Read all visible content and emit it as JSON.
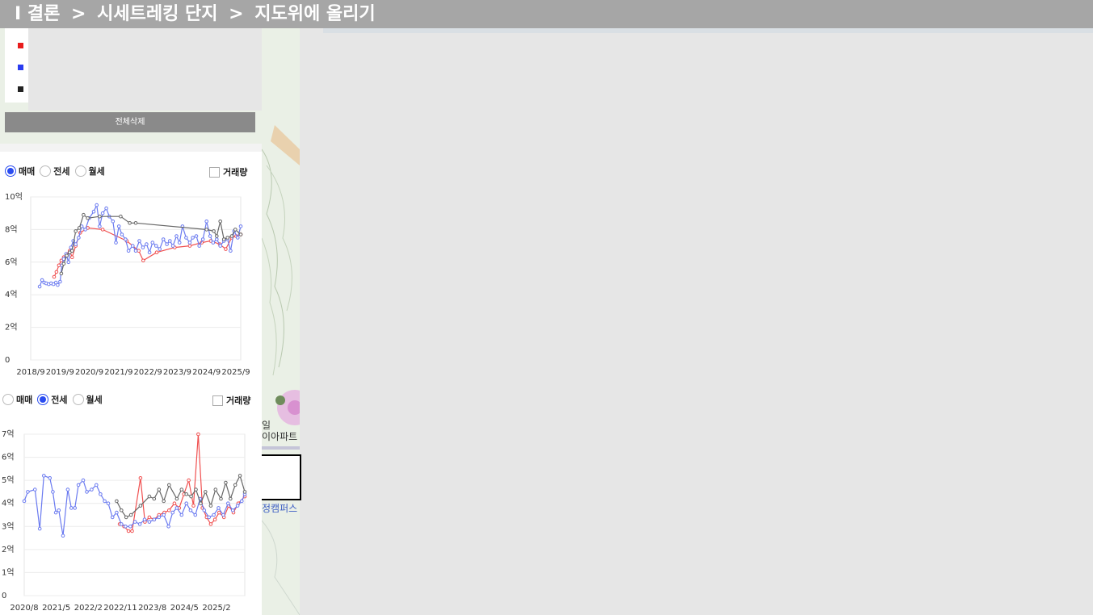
{
  "breadcrumb": {
    "prefix": "I",
    "items": [
      "결론",
      "시세트레킹 단지",
      "지도위에 올리기"
    ],
    "separator": ">"
  },
  "map": {
    "labels": [
      "일",
      "이아파트",
      "정캠퍼스"
    ]
  },
  "legend": {
    "colors": [
      "#e81c1c",
      "#2a3cf0",
      "#222222"
    ]
  },
  "delete_all_label": "전체삭제",
  "charts": [
    {
      "radios": [
        {
          "label": "매매",
          "checked": true
        },
        {
          "label": "전세",
          "checked": false
        },
        {
          "label": "월세",
          "checked": false
        }
      ],
      "volume_label": "거래량",
      "chart_data": {
        "type": "line",
        "y_ticks": [
          "10억",
          "8억",
          "6억",
          "4억",
          "2억",
          "0"
        ],
        "ylim": [
          0,
          10
        ],
        "x_ticks": [
          "2018/9",
          "2019/9",
          "2020/9",
          "2021/9",
          "2022/9",
          "2023/9",
          "2024/9",
          "2025/9"
        ],
        "xlim": [
          0,
          7
        ],
        "grid": true,
        "series": [
          {
            "color": "#f05050",
            "points": [
              [
                0.78,
                5.1
              ],
              [
                0.86,
                5.4
              ],
              [
                0.94,
                5.8
              ],
              [
                1.02,
                6.1
              ],
              [
                1.1,
                6.3
              ],
              [
                1.2,
                6.5
              ],
              [
                1.3,
                6.7
              ],
              [
                1.38,
                6.3
              ],
              [
                1.5,
                7.0
              ],
              [
                1.65,
                7.8
              ],
              [
                1.9,
                8.1
              ],
              [
                2.4,
                8.0
              ],
              [
                3.2,
                7.3
              ],
              [
                3.6,
                6.7
              ],
              [
                3.75,
                6.1
              ],
              [
                4.2,
                6.6
              ],
              [
                4.8,
                6.9
              ],
              [
                5.3,
                7.0
              ],
              [
                5.7,
                7.2
              ],
              [
                6.0,
                7.3
              ],
              [
                6.3,
                7.1
              ],
              [
                6.5,
                6.8
              ],
              [
                6.7,
                7.5
              ],
              [
                6.85,
                7.6
              ],
              [
                7.0,
                7.7
              ]
            ]
          },
          {
            "color": "#6a7af0",
            "points": [
              [
                0.3,
                4.5
              ],
              [
                0.38,
                4.9
              ],
              [
                0.45,
                4.75
              ],
              [
                0.52,
                4.7
              ],
              [
                0.6,
                4.65
              ],
              [
                0.68,
                4.7
              ],
              [
                0.76,
                4.65
              ],
              [
                0.84,
                4.75
              ],
              [
                0.9,
                4.6
              ],
              [
                0.98,
                4.8
              ],
              [
                1.04,
                5.8
              ],
              [
                1.1,
                6.2
              ],
              [
                1.18,
                6.5
              ],
              [
                1.26,
                6.0
              ],
              [
                1.34,
                6.9
              ],
              [
                1.42,
                7.3
              ],
              [
                1.5,
                7.1
              ],
              [
                1.6,
                7.5
              ],
              [
                1.7,
                8.2
              ],
              [
                1.82,
                8.0
              ],
              [
                1.95,
                8.7
              ],
              [
                2.1,
                9.1
              ],
              [
                2.2,
                9.5
              ],
              [
                2.3,
                8.2
              ],
              [
                2.4,
                9.0
              ],
              [
                2.52,
                9.3
              ],
              [
                2.62,
                8.8
              ],
              [
                2.74,
                8.5
              ],
              [
                2.84,
                7.2
              ],
              [
                2.94,
                8.2
              ],
              [
                3.04,
                7.7
              ],
              [
                3.16,
                7.4
              ],
              [
                3.26,
                6.7
              ],
              [
                3.4,
                7.0
              ],
              [
                3.5,
                6.7
              ],
              [
                3.62,
                7.3
              ],
              [
                3.74,
                6.9
              ],
              [
                3.86,
                7.1
              ],
              [
                3.96,
                6.6
              ],
              [
                4.06,
                7.2
              ],
              [
                4.18,
                7.0
              ],
              [
                4.3,
                6.8
              ],
              [
                4.42,
                7.4
              ],
              [
                4.54,
                7.1
              ],
              [
                4.64,
                7.3
              ],
              [
                4.74,
                7.0
              ],
              [
                4.86,
                7.6
              ],
              [
                4.96,
                7.2
              ],
              [
                5.06,
                8.2
              ],
              [
                5.18,
                7.5
              ],
              [
                5.3,
                7.2
              ],
              [
                5.4,
                7.5
              ],
              [
                5.52,
                7.6
              ],
              [
                5.62,
                7.0
              ],
              [
                5.74,
                7.4
              ],
              [
                5.86,
                8.5
              ],
              [
                5.98,
                7.6
              ],
              [
                6.08,
                7.2
              ],
              [
                6.2,
                7.4
              ],
              [
                6.32,
                7.0
              ],
              [
                6.44,
                7.3
              ],
              [
                6.56,
                7.4
              ],
              [
                6.66,
                6.7
              ],
              [
                6.78,
                7.9
              ],
              [
                6.9,
                7.5
              ],
              [
                7.0,
                8.2
              ]
            ]
          },
          {
            "color": "#666666",
            "points": [
              [
                1.02,
                5.3
              ],
              [
                1.1,
                5.9
              ],
              [
                1.2,
                6.4
              ],
              [
                1.3,
                6.6
              ],
              [
                1.38,
                6.7
              ],
              [
                1.5,
                7.9
              ],
              [
                1.62,
                8.1
              ],
              [
                1.76,
                8.9
              ],
              [
                1.9,
                8.7
              ],
              [
                2.3,
                8.8
              ],
              [
                3.0,
                8.8
              ],
              [
                3.3,
                8.4
              ],
              [
                3.5,
                8.4
              ],
              [
                5.86,
                8.0
              ],
              [
                6.1,
                7.9
              ],
              [
                6.2,
                7.6
              ],
              [
                6.32,
                8.5
              ],
              [
                6.44,
                7.4
              ],
              [
                6.56,
                7.5
              ],
              [
                6.7,
                7.6
              ],
              [
                6.82,
                8.0
              ],
              [
                7.0,
                7.7
              ]
            ]
          }
        ]
      }
    },
    {
      "radios": [
        {
          "label": "매매",
          "checked": false
        },
        {
          "label": "전세",
          "checked": true
        },
        {
          "label": "월세",
          "checked": false
        }
      ],
      "volume_label": "거래량",
      "chart_data": {
        "type": "line",
        "y_ticks": [
          "7억",
          "6억",
          "5억",
          "4억",
          "3억",
          "2억",
          "1억",
          "0"
        ],
        "ylim": [
          0,
          7
        ],
        "x_ticks": [
          "2020/8",
          "2021/5",
          "2022/2",
          "2022/11",
          "2023/8",
          "2024/5",
          "2025/2"
        ],
        "xlim": [
          0,
          7.4
        ],
        "grid": true,
        "series": [
          {
            "color": "#f05050",
            "points": [
              [
                3.2,
                3.1
              ],
              [
                3.35,
                3.0
              ],
              [
                3.5,
                2.8
              ],
              [
                3.62,
                2.8
              ],
              [
                3.9,
                5.1
              ],
              [
                4.05,
                3.2
              ],
              [
                4.2,
                3.4
              ],
              [
                4.36,
                3.3
              ],
              [
                4.52,
                3.5
              ],
              [
                4.7,
                3.6
              ],
              [
                4.86,
                3.7
              ],
              [
                5.04,
                4.0
              ],
              [
                5.2,
                3.8
              ],
              [
                5.36,
                4.4
              ],
              [
                5.52,
                5.0
              ],
              [
                5.68,
                3.9
              ],
              [
                5.84,
                7.0
              ],
              [
                5.98,
                3.8
              ],
              [
                6.12,
                3.4
              ],
              [
                6.26,
                3.1
              ],
              [
                6.4,
                3.3
              ],
              [
                6.54,
                3.6
              ],
              [
                6.7,
                3.4
              ],
              [
                6.86,
                3.9
              ],
              [
                7.02,
                3.6
              ],
              [
                7.18,
                4.0
              ],
              [
                7.4,
                4.3
              ]
            ]
          },
          {
            "color": "#6a7af0",
            "points": [
              [
                0.0,
                4.1
              ],
              [
                0.12,
                4.5
              ],
              [
                0.36,
                4.6
              ],
              [
                0.52,
                2.9
              ],
              [
                0.66,
                5.2
              ],
              [
                0.86,
                5.1
              ],
              [
                0.96,
                4.5
              ],
              [
                1.06,
                3.6
              ],
              [
                1.16,
                3.7
              ],
              [
                1.3,
                2.6
              ],
              [
                1.46,
                4.6
              ],
              [
                1.58,
                3.8
              ],
              [
                1.7,
                3.8
              ],
              [
                1.82,
                4.8
              ],
              [
                1.98,
                5.0
              ],
              [
                2.1,
                4.5
              ],
              [
                2.26,
                4.6
              ],
              [
                2.42,
                4.8
              ],
              [
                2.56,
                4.4
              ],
              [
                2.7,
                4.1
              ],
              [
                2.82,
                4.0
              ],
              [
                2.96,
                3.4
              ],
              [
                3.1,
                3.6
              ],
              [
                3.26,
                3.1
              ],
              [
                3.4,
                3.0
              ],
              [
                3.56,
                3.0
              ],
              [
                3.72,
                3.2
              ],
              [
                3.88,
                3.1
              ],
              [
                4.04,
                3.3
              ],
              [
                4.2,
                3.2
              ],
              [
                4.36,
                3.3
              ],
              [
                4.52,
                3.4
              ],
              [
                4.68,
                3.5
              ],
              [
                4.84,
                3.0
              ],
              [
                4.98,
                3.6
              ],
              [
                5.12,
                3.8
              ],
              [
                5.28,
                3.5
              ],
              [
                5.44,
                4.0
              ],
              [
                5.58,
                3.7
              ],
              [
                5.74,
                3.5
              ],
              [
                5.9,
                4.2
              ],
              [
                6.04,
                3.7
              ],
              [
                6.2,
                3.4
              ],
              [
                6.36,
                3.5
              ],
              [
                6.52,
                3.8
              ],
              [
                6.68,
                3.5
              ],
              [
                6.84,
                4.0
              ],
              [
                7.0,
                3.7
              ],
              [
                7.16,
                3.9
              ],
              [
                7.3,
                4.1
              ],
              [
                7.4,
                4.4
              ]
            ]
          },
          {
            "color": "#666666",
            "points": [
              [
                3.1,
                4.1
              ],
              [
                3.26,
                3.7
              ],
              [
                3.42,
                3.4
              ],
              [
                3.58,
                3.5
              ],
              [
                3.9,
                3.9
              ],
              [
                4.2,
                4.3
              ],
              [
                4.36,
                4.2
              ],
              [
                4.52,
                4.6
              ],
              [
                4.68,
                4.1
              ],
              [
                4.86,
                4.8
              ],
              [
                5.12,
                4.2
              ],
              [
                5.28,
                4.6
              ],
              [
                5.44,
                4.4
              ],
              [
                5.6,
                4.3
              ],
              [
                5.76,
                4.6
              ],
              [
                5.92,
                4.0
              ],
              [
                6.08,
                4.5
              ],
              [
                6.26,
                3.9
              ],
              [
                6.42,
                4.6
              ],
              [
                6.6,
                4.2
              ],
              [
                6.76,
                4.9
              ],
              [
                6.92,
                4.2
              ],
              [
                7.08,
                4.8
              ],
              [
                7.24,
                5.2
              ],
              [
                7.4,
                4.5
              ]
            ]
          }
        ]
      }
    }
  ]
}
